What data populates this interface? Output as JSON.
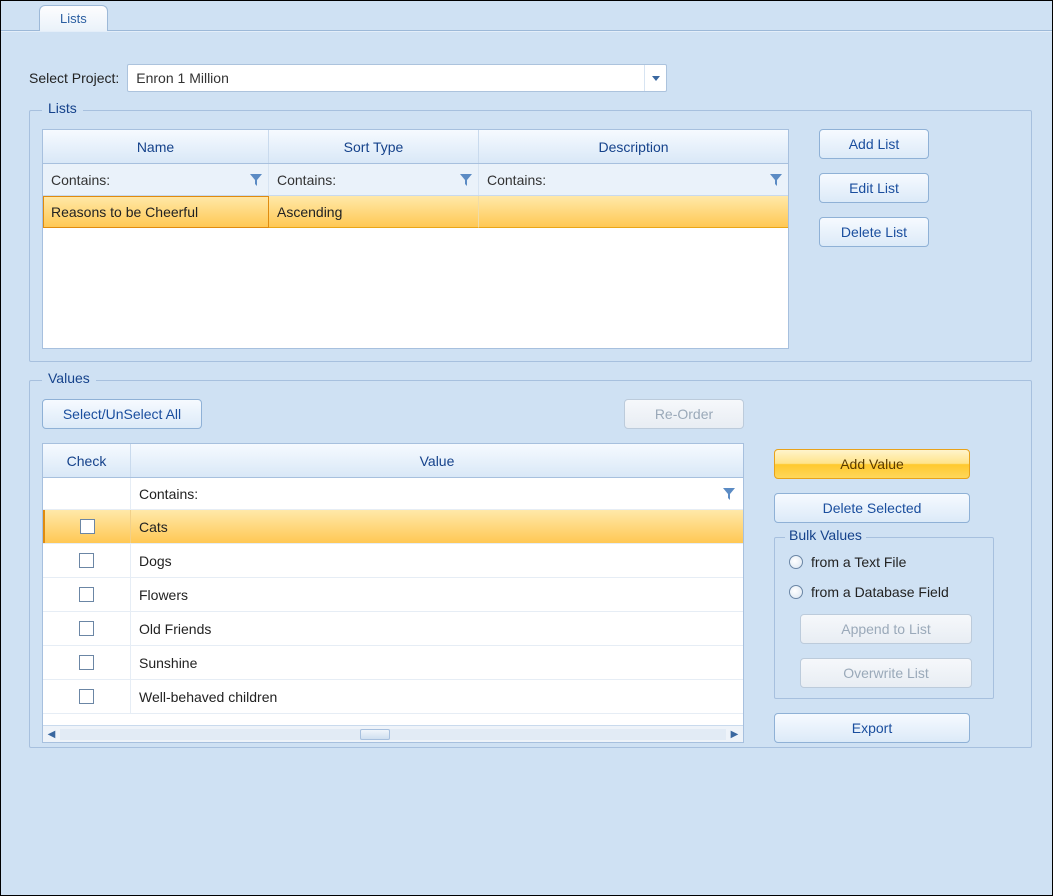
{
  "tab": {
    "title": "Lists"
  },
  "project": {
    "label": "Select Project:",
    "selected": "Enron 1 Million"
  },
  "lists_group": {
    "title": "Lists",
    "headers": {
      "name": "Name",
      "sort": "Sort Type",
      "desc": "Description"
    },
    "filter_label": "Contains:",
    "rows": [
      {
        "name": "Reasons to be Cheerful",
        "sort": "Ascending",
        "desc": "",
        "selected": true
      }
    ],
    "buttons": {
      "add": "Add List",
      "edit": "Edit List",
      "delete": "Delete List"
    }
  },
  "values_group": {
    "title": "Values",
    "select_all": "Select/UnSelect All",
    "reorder": "Re-Order",
    "headers": {
      "check": "Check",
      "value": "Value"
    },
    "filter_label": "Contains:",
    "rows": [
      {
        "checked": false,
        "value": "Cats",
        "selected": true
      },
      {
        "checked": false,
        "value": "Dogs",
        "selected": false
      },
      {
        "checked": false,
        "value": "Flowers",
        "selected": false
      },
      {
        "checked": false,
        "value": "Old Friends",
        "selected": false
      },
      {
        "checked": false,
        "value": "Sunshine",
        "selected": false
      },
      {
        "checked": false,
        "value": "Well-behaved children",
        "selected": false
      }
    ],
    "buttons": {
      "add": "Add Value",
      "delete_sel": "Delete Selected"
    },
    "bulk": {
      "title": "Bulk Values",
      "radio_text": "from a Text File",
      "radio_db": "from a Database Field",
      "append": "Append to List",
      "overwrite": "Overwrite List"
    },
    "export": "Export"
  }
}
